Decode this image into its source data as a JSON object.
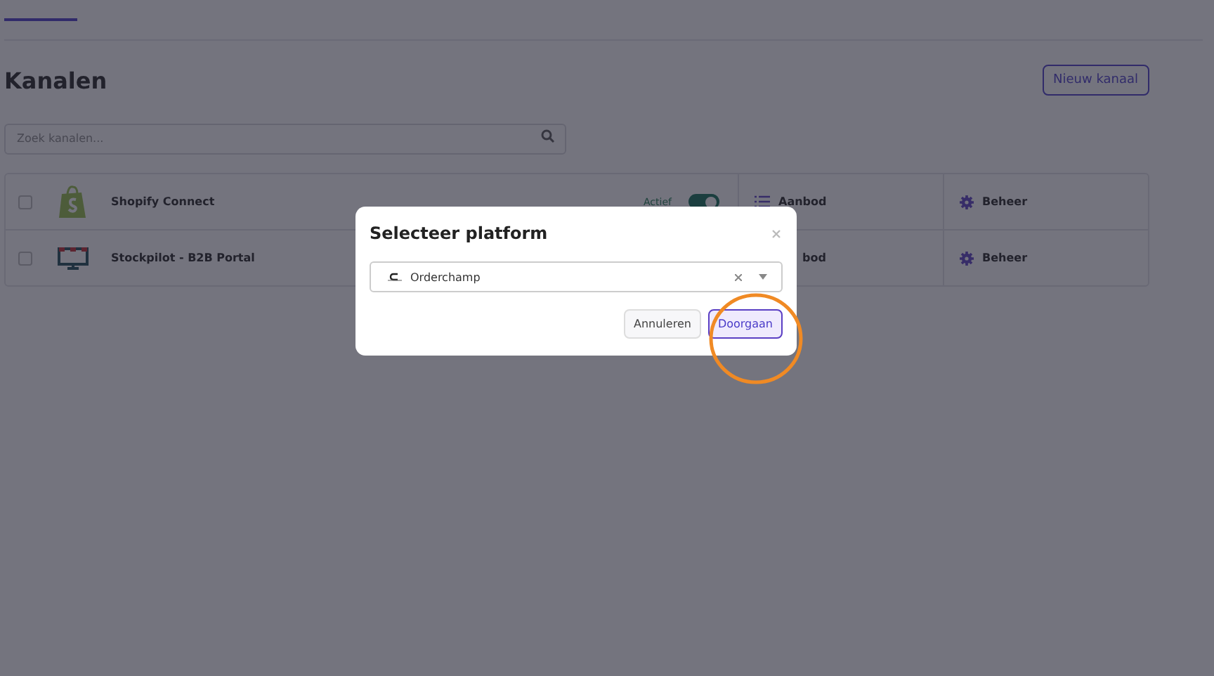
{
  "page": {
    "title": "Kanalen",
    "new_button": "Nieuw kanaal",
    "search": {
      "placeholder": "Zoek kanalen..."
    }
  },
  "channels": [
    {
      "name": "Shopify Connect",
      "checked": false,
      "status": {
        "label": "Actief",
        "on": true
      },
      "actions": [
        {
          "label": "Aanbod",
          "kind": "offer"
        },
        {
          "label": "Beheer",
          "kind": "manage"
        }
      ]
    },
    {
      "name": "Stockpilot - B2B Portal",
      "checked": false,
      "actions": [
        {
          "label": "bod",
          "kind": "partial"
        },
        {
          "label": "Beheer",
          "kind": "manage"
        }
      ]
    }
  ],
  "dialog": {
    "title": "Selecteer platform",
    "select": {
      "value": "Orderchamp"
    },
    "buttons": [
      {
        "label": "Annuleren",
        "kind": "secondary"
      },
      {
        "label": "Doorgaan",
        "kind": "primary"
      }
    ]
  }
}
